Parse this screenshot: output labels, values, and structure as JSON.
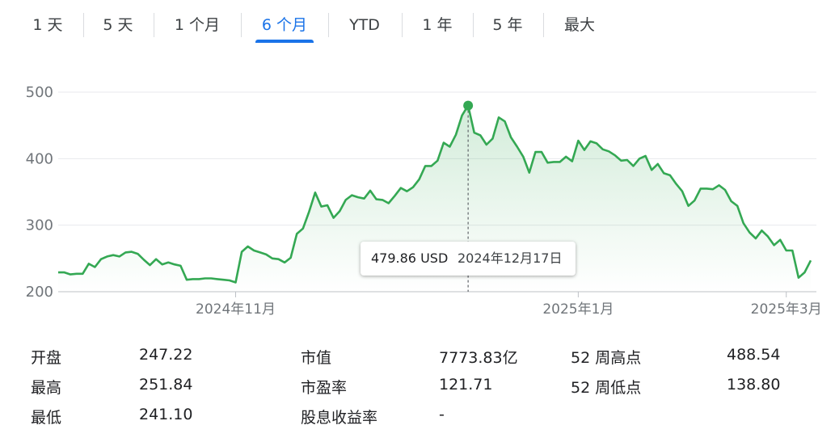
{
  "tabs": [
    {
      "label": "1 天",
      "active": false
    },
    {
      "label": "5 天",
      "active": false
    },
    {
      "label": "1 个月",
      "active": false
    },
    {
      "label": "6 个月",
      "active": true
    },
    {
      "label": "YTD",
      "active": false
    },
    {
      "label": "1 年",
      "active": false
    },
    {
      "label": "5 年",
      "active": false
    },
    {
      "label": "最大",
      "active": false
    }
  ],
  "chart_data": {
    "type": "area",
    "line_color": "#34a853",
    "y_ticks": [
      200,
      300,
      400,
      500
    ],
    "ylim": [
      200,
      510
    ],
    "x_tick_labels": [
      "2024年11月",
      "2025年1月",
      "2025年3月"
    ],
    "grid": "horizontal",
    "series": [
      {
        "values": [
          229,
          229,
          226,
          227,
          227,
          242,
          237,
          249,
          253,
          255,
          253,
          259,
          260,
          257,
          248,
          240,
          249,
          241,
          244,
          241,
          239,
          218,
          219,
          219,
          220,
          220,
          219,
          218,
          217,
          214,
          260,
          268,
          262,
          259,
          256,
          250,
          249,
          244,
          251,
          287,
          295,
          320,
          349,
          328,
          330,
          311,
          321,
          338,
          345,
          342,
          340,
          352,
          339,
          338,
          333,
          344,
          356,
          351,
          357,
          369,
          389,
          389,
          397,
          424,
          418,
          436,
          465,
          479.86,
          439,
          435,
          421,
          430,
          462,
          456,
          432,
          418,
          403,
          379,
          410,
          410,
          394,
          395,
          395,
          403,
          396,
          427,
          413,
          426,
          423,
          414,
          411,
          405,
          397,
          398,
          389,
          400,
          404,
          383,
          392,
          378,
          375,
          362,
          351,
          329,
          337,
          355,
          355,
          354,
          360,
          353,
          336,
          329,
          303,
          289,
          280,
          292,
          283,
          270,
          278,
          262,
          262,
          221,
          229,
          247
        ]
      }
    ],
    "tooltip": {
      "price": "479.86 USD",
      "date": "2024年12月17日"
    }
  },
  "stats": {
    "rows": [
      [
        {
          "label": "开盘",
          "value": "247.22"
        },
        {
          "label": "市值",
          "value": "7773.83亿"
        },
        {
          "label": "52 周高点",
          "value": "488.54"
        }
      ],
      [
        {
          "label": "最高",
          "value": "251.84"
        },
        {
          "label": "市盈率",
          "value": "121.71"
        },
        {
          "label": "52 周低点",
          "value": "138.80"
        }
      ],
      [
        {
          "label": "最低",
          "value": "241.10"
        },
        {
          "label": "股息收益率",
          "value": "-"
        }
      ]
    ]
  }
}
